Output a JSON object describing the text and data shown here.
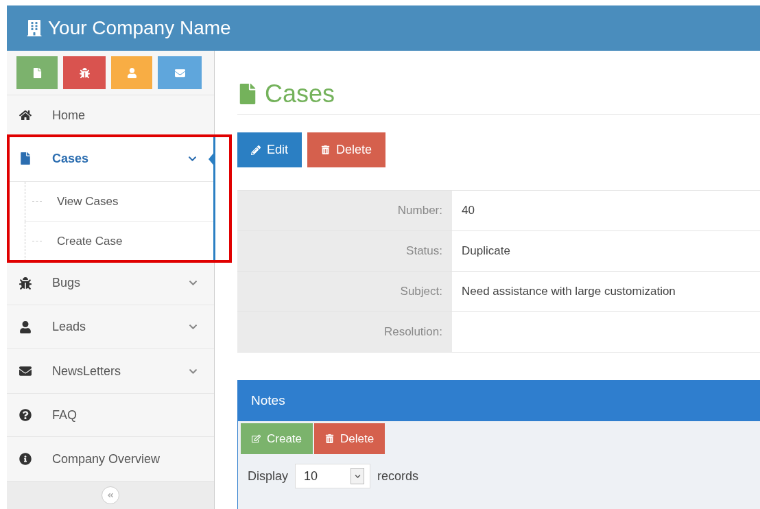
{
  "header": {
    "title": "Your Company Name"
  },
  "shortcuts": [
    {
      "kind": "file",
      "color": "#7cb26d"
    },
    {
      "kind": "bug",
      "color": "#d9534f"
    },
    {
      "kind": "user",
      "color": "#f8ad44"
    },
    {
      "kind": "envelope",
      "color": "#5fa6dc"
    }
  ],
  "nav": [
    {
      "label": "Home",
      "kind": "home",
      "selected": false
    },
    {
      "label": "Cases",
      "kind": "file",
      "selected": true,
      "expanded": true,
      "highlighted": true,
      "children": [
        {
          "label": "View Cases"
        },
        {
          "label": "Create Case"
        }
      ]
    },
    {
      "label": "Bugs",
      "kind": "bug",
      "selected": false,
      "expanded": false
    },
    {
      "label": "Leads",
      "kind": "user",
      "selected": false,
      "expanded": false
    },
    {
      "label": "NewsLetters",
      "kind": "envelope",
      "selected": false,
      "expanded": false
    },
    {
      "label": "FAQ",
      "kind": "question",
      "selected": false
    },
    {
      "label": "Company Overview",
      "kind": "info",
      "selected": false
    }
  ],
  "page": {
    "title": "Cases",
    "actions": [
      {
        "label": "Edit",
        "kind": "edit"
      },
      {
        "label": "Delete",
        "kind": "delete"
      }
    ]
  },
  "details": [
    {
      "label": "Number:",
      "value": "40"
    },
    {
      "label": "Status:",
      "value": "Duplicate"
    },
    {
      "label": "Subject:",
      "value": "Need assistance with large customization"
    },
    {
      "label": "Resolution:"
    }
  ],
  "notes": {
    "title": "Notes",
    "actions": [
      {
        "label": "Create",
        "kind": "create"
      },
      {
        "label": "Delete",
        "kind": "delete"
      }
    ],
    "display_label": "Display",
    "page_size": "10",
    "records_label": "records"
  }
}
